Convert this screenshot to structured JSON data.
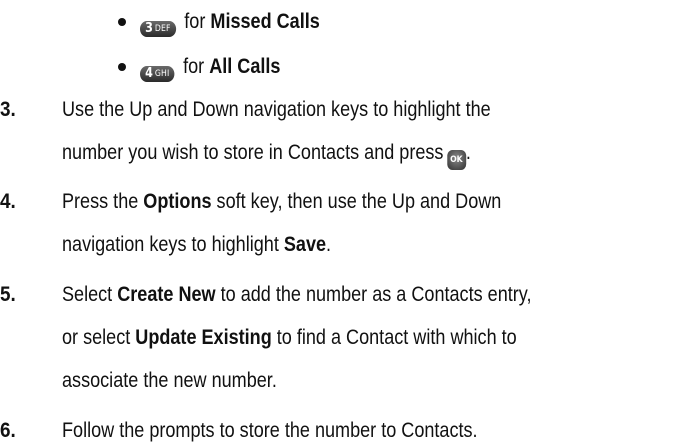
{
  "bullets": [
    {
      "key_digit": "3",
      "key_letters": "DEF",
      "prefix": "for",
      "bold": "Missed Calls"
    },
    {
      "key_digit": "4",
      "key_letters": "GHI",
      "prefix": "for",
      "bold": "All Calls"
    }
  ],
  "steps": [
    {
      "number": "3.",
      "lines": [
        {
          "parts": [
            {
              "t": "Use the Up and Down navigation keys to highlight the",
              "b": false
            }
          ]
        },
        {
          "parts": [
            {
              "t": "number you wish to store in Contacts and press",
              "b": false
            }
          ],
          "ok_key": "OK",
          "after": "."
        }
      ]
    },
    {
      "number": "4.",
      "lines": [
        {
          "parts": [
            {
              "t": "Press the ",
              "b": false
            },
            {
              "t": "Options",
              "b": true
            },
            {
              "t": " soft key, then use the Up and Down",
              "b": false
            }
          ]
        },
        {
          "parts": [
            {
              "t": "navigation keys to highlight ",
              "b": false
            },
            {
              "t": "Save",
              "b": true
            },
            {
              "t": ".",
              "b": false
            }
          ]
        }
      ]
    },
    {
      "number": "5.",
      "lines": [
        {
          "parts": [
            {
              "t": "Select ",
              "b": false
            },
            {
              "t": "Create New",
              "b": true
            },
            {
              "t": " to add the number as a Contacts entry,",
              "b": false
            }
          ]
        },
        {
          "parts": [
            {
              "t": "or select ",
              "b": false
            },
            {
              "t": "Update Existing",
              "b": true
            },
            {
              "t": " to find a Contact with which to",
              "b": false
            }
          ]
        },
        {
          "parts": [
            {
              "t": "associate the new number.",
              "b": false
            }
          ]
        }
      ]
    },
    {
      "number": "6.",
      "lines": [
        {
          "parts": [
            {
              "t": "Follow the prompts to store the number to Contacts.",
              "b": false
            }
          ]
        }
      ]
    }
  ]
}
